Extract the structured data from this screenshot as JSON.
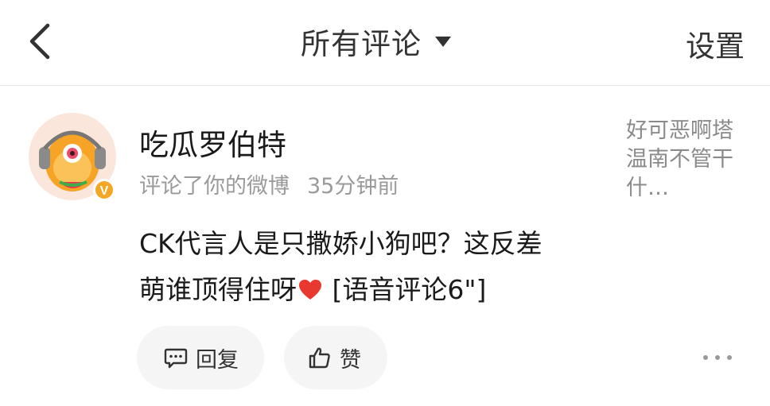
{
  "header": {
    "back_icon": "chevron-left-icon",
    "title": "所有评论",
    "dropdown_icon": "caret-down-icon",
    "settings_label": "设置"
  },
  "notification": {
    "avatar_icon": "avatar-icon",
    "verified_badge": "V",
    "username": "吃瓜罗伯特",
    "action": "评论了你的微博",
    "time": "35分钟前",
    "comment_text_line1": "CK代言人是只撒娇小狗吧？这反差",
    "comment_text_line2_prefix": "萌谁顶得住呀",
    "heart_icon": "heart-icon",
    "comment_text_line2_suffix": " [语音评论6\"]",
    "original_post_preview": "好可恶啊塔温南不管干什…"
  },
  "actions": {
    "reply_label": "回复",
    "reply_icon": "comment-icon",
    "like_label": "赞",
    "like_icon": "thumbs-up-icon",
    "more_icon": "more-dots-icon"
  },
  "colors": {
    "heart": "#e8382f",
    "badge": "#f5a623",
    "pill_bg": "#f5f5f5",
    "secondary_text": "#9a9a9a"
  }
}
